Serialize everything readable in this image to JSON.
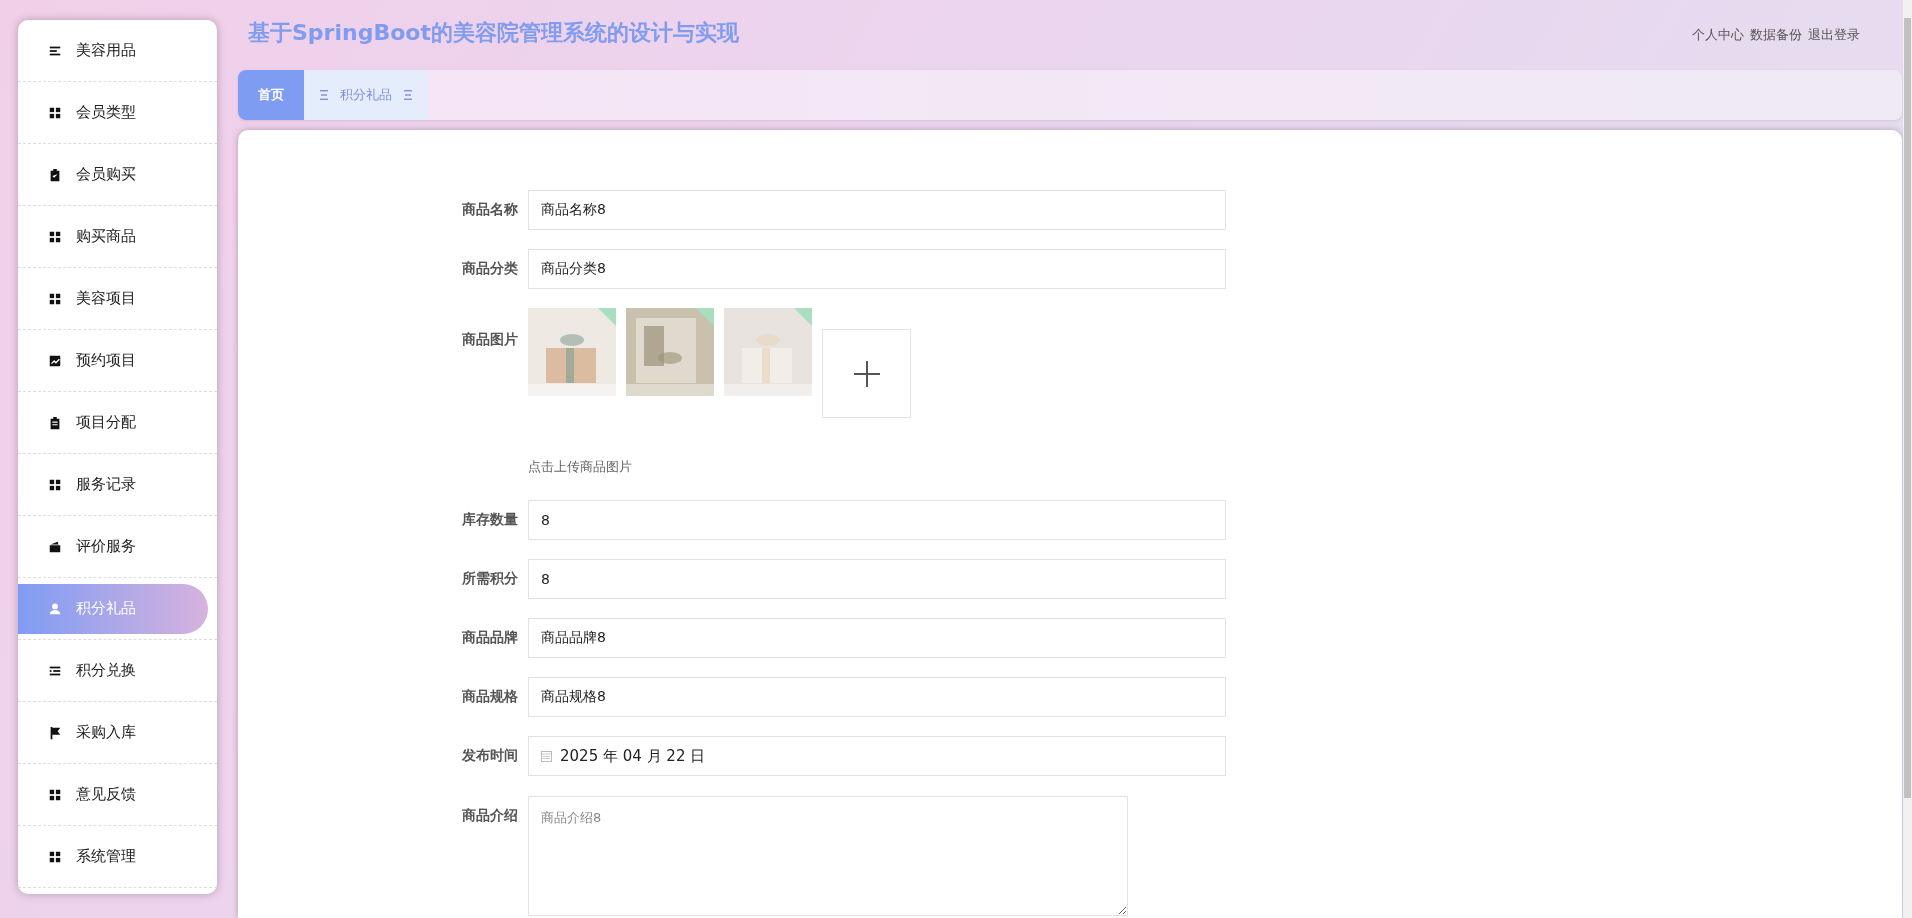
{
  "header": {
    "title": "基于SpringBoot的美容院管理系统的设计与实现",
    "links": [
      "个人中心",
      "数据备份",
      "退出登录"
    ]
  },
  "sidebar": {
    "items": [
      {
        "label": "美容用品",
        "selected": false
      },
      {
        "label": "会员类型",
        "selected": false
      },
      {
        "label": "会员购买",
        "selected": false
      },
      {
        "label": "购买商品",
        "selected": false
      },
      {
        "label": "美容项目",
        "selected": false
      },
      {
        "label": "预约项目",
        "selected": false
      },
      {
        "label": "项目分配",
        "selected": false
      },
      {
        "label": "服务记录",
        "selected": false
      },
      {
        "label": "评价服务",
        "selected": false
      },
      {
        "label": "积分礼品",
        "selected": true
      },
      {
        "label": "积分兑换",
        "selected": false
      },
      {
        "label": "采购入库",
        "selected": false
      },
      {
        "label": "意见反馈",
        "selected": false
      },
      {
        "label": "系统管理",
        "selected": false
      }
    ]
  },
  "tabs": [
    {
      "label": "首页",
      "selected": true
    },
    {
      "label": "积分礼品",
      "selected": false
    }
  ],
  "form": {
    "fields": [
      {
        "kind": "text",
        "label": "商品名称",
        "value": "商品名称8"
      },
      {
        "kind": "text",
        "label": "商品分类",
        "value": "商品分类8"
      },
      {
        "kind": "images",
        "label": "商品图片",
        "hint": "点击上传商品图片"
      },
      {
        "kind": "text",
        "label": "库存数量",
        "value": "8"
      },
      {
        "kind": "text",
        "label": "所需积分",
        "value": "8"
      },
      {
        "kind": "text",
        "label": "商品品牌",
        "value": "商品品牌8"
      },
      {
        "kind": "text",
        "label": "商品规格",
        "value": "商品规格8"
      },
      {
        "kind": "date",
        "label": "发布时间",
        "value": "2025 年 04 月 22 日"
      },
      {
        "kind": "textarea",
        "label": "商品介绍",
        "placeholder": "商品介绍8"
      }
    ]
  }
}
